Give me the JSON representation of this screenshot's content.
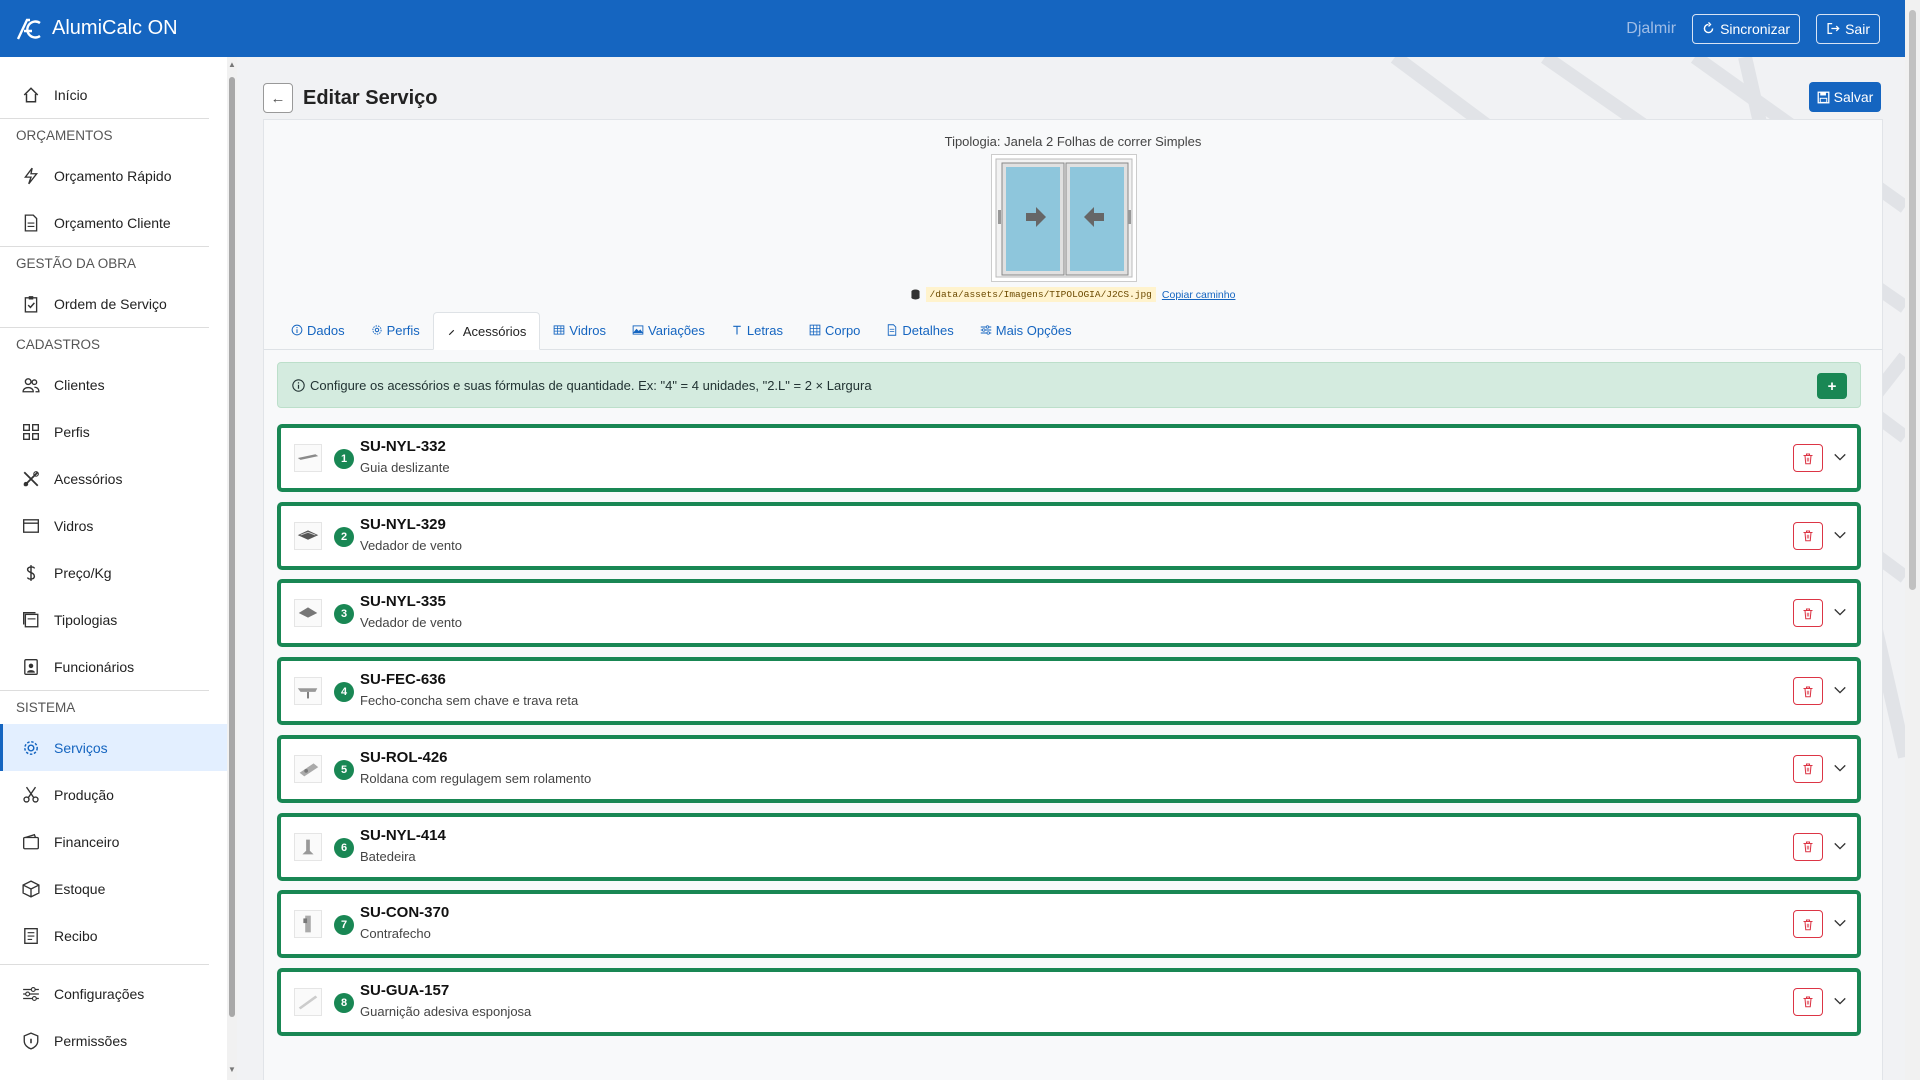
{
  "app": {
    "title": "AlumiCalc ON"
  },
  "topbar": {
    "user": "Djalmir",
    "sync_label": "Sincronizar",
    "logout_label": "Sair"
  },
  "sidebar": {
    "home": "Início",
    "sections": [
      {
        "title": "ORÇAMENTOS",
        "items": [
          {
            "label": "Orçamento Rápido",
            "icon": "lightning-icon"
          },
          {
            "label": "Orçamento Cliente",
            "icon": "document-icon"
          }
        ]
      },
      {
        "title": "GESTÃO DA OBRA",
        "items": [
          {
            "label": "Ordem de Serviço",
            "icon": "clipboard-check-icon"
          }
        ]
      },
      {
        "title": "CADASTROS",
        "items": [
          {
            "label": "Clientes",
            "icon": "people-icon"
          },
          {
            "label": "Perfis",
            "icon": "grid-icon"
          },
          {
            "label": "Acessórios",
            "icon": "tools-icon"
          },
          {
            "label": "Vidros",
            "icon": "window-icon"
          },
          {
            "label": "Preço/Kg",
            "icon": "dollar-icon"
          },
          {
            "label": "Tipologias",
            "icon": "stack-icon"
          },
          {
            "label": "Funcionários",
            "icon": "badge-icon"
          }
        ]
      },
      {
        "title": "SISTEMA",
        "items": [
          {
            "label": "Serviços",
            "icon": "gear-icon",
            "active": true
          },
          {
            "label": "Produção",
            "icon": "scissors-icon"
          },
          {
            "label": "Financeiro",
            "icon": "wallet-icon"
          },
          {
            "label": "Estoque",
            "icon": "box-icon"
          },
          {
            "label": "Recibo",
            "icon": "receipt-icon"
          }
        ]
      }
    ],
    "footer": [
      {
        "label": "Configurações",
        "icon": "sliders-icon"
      },
      {
        "label": "Permissões",
        "icon": "shield-icon"
      }
    ]
  },
  "page": {
    "title": "Editar Serviço",
    "save_label": "Salvar"
  },
  "tipologia": {
    "label": "Tipologia: Janela 2 Folhas de correr Simples",
    "path": "/data/assets/Imagens/TIPOLOGIA/J2CS.jpg",
    "copy_label": "Copiar caminho"
  },
  "tabs": [
    {
      "label": "Dados",
      "icon": "info-icon"
    },
    {
      "label": "Perfis",
      "icon": "gear-icon"
    },
    {
      "label": "Acessórios",
      "icon": "wrench-icon",
      "active": true
    },
    {
      "label": "Vidros",
      "icon": "table-icon"
    },
    {
      "label": "Variações",
      "icon": "image-icon"
    },
    {
      "label": "Letras",
      "icon": "text-icon"
    },
    {
      "label": "Corpo",
      "icon": "grid-icon"
    },
    {
      "label": "Detalhes",
      "icon": "file-icon"
    },
    {
      "label": "Mais Opções",
      "icon": "sliders-icon"
    }
  ],
  "info": {
    "text": "Configure os acessórios e suas fórmulas de quantidade. Ex: \"4\" = 4 unidades, \"2.L\" = 2 × Largura",
    "add_label": "+"
  },
  "accessories": [
    {
      "n": "1",
      "code": "SU-NYL-332",
      "desc": "Guia deslizante"
    },
    {
      "n": "2",
      "code": "SU-NYL-329",
      "desc": "Vedador de vento"
    },
    {
      "n": "3",
      "code": "SU-NYL-335",
      "desc": "Vedador de vento"
    },
    {
      "n": "4",
      "code": "SU-FEC-636",
      "desc": "Fecho-concha sem chave e trava reta"
    },
    {
      "n": "5",
      "code": "SU-ROL-426",
      "desc": "Roldana com regulagem sem rolamento"
    },
    {
      "n": "6",
      "code": "SU-NYL-414",
      "desc": "Batedeira"
    },
    {
      "n": "7",
      "code": "SU-CON-370",
      "desc": "Contrafecho"
    },
    {
      "n": "8",
      "code": "SU-GUA-157",
      "desc": "Guarnição adesiva esponjosa"
    }
  ]
}
